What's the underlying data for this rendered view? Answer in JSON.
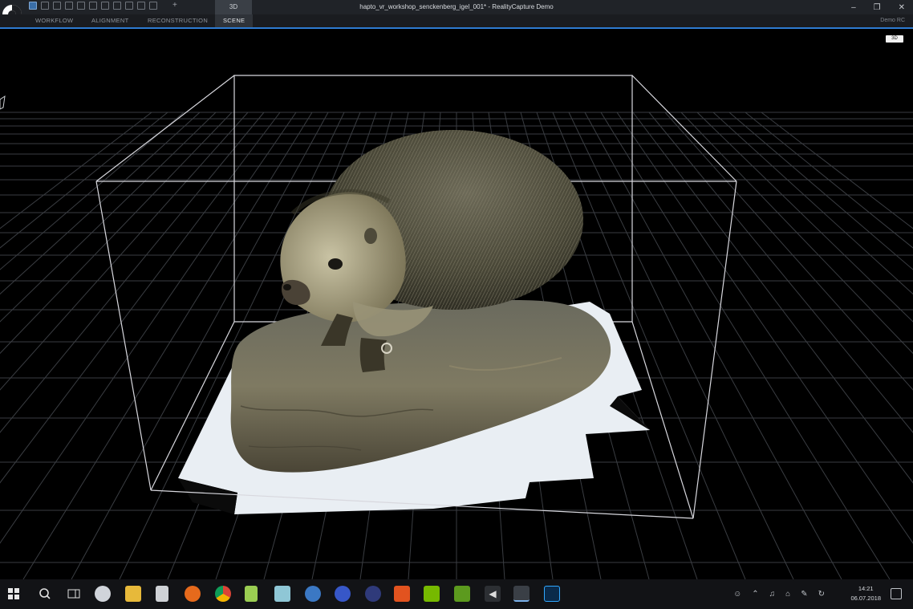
{
  "titlebar": {
    "window_title": "hapto_vr_workshop_senckenberg_igel_001* - RealityCapture Demo",
    "context_tab": "3D",
    "minimize_icon": "minimize-icon",
    "restore_icon": "restore-icon",
    "close_icon": "close-icon"
  },
  "ribbon": {
    "tabs": [
      {
        "label": "WORKFLOW"
      },
      {
        "label": "ALIGNMENT"
      },
      {
        "label": "RECONSTRUCTION"
      },
      {
        "label": "SCENE"
      }
    ],
    "selected_tab": "SCENE",
    "user_label": "Demo RC",
    "accent_color": "#2e7bd1"
  },
  "viewport": {
    "view_badge": "3D",
    "scene_object": "textured hedgehog model on stone base inside reconstruction region box"
  },
  "taskbar": {
    "icons": [
      "windows-start-icon",
      "search-icon",
      "task-view-icon",
      "app-icon",
      "file-explorer-icon",
      "calculator-icon",
      "firefox-icon",
      "chrome-icon",
      "notepad-icon",
      "app-icon",
      "app-icon",
      "app-icon",
      "app-icon",
      "app-icon",
      "nvidia-icon",
      "nvidia-icon",
      "audio-icon",
      "realitycapture-icon",
      "photoshop-icon"
    ],
    "clock_time": "14:21",
    "clock_date": "06.07.2018"
  }
}
